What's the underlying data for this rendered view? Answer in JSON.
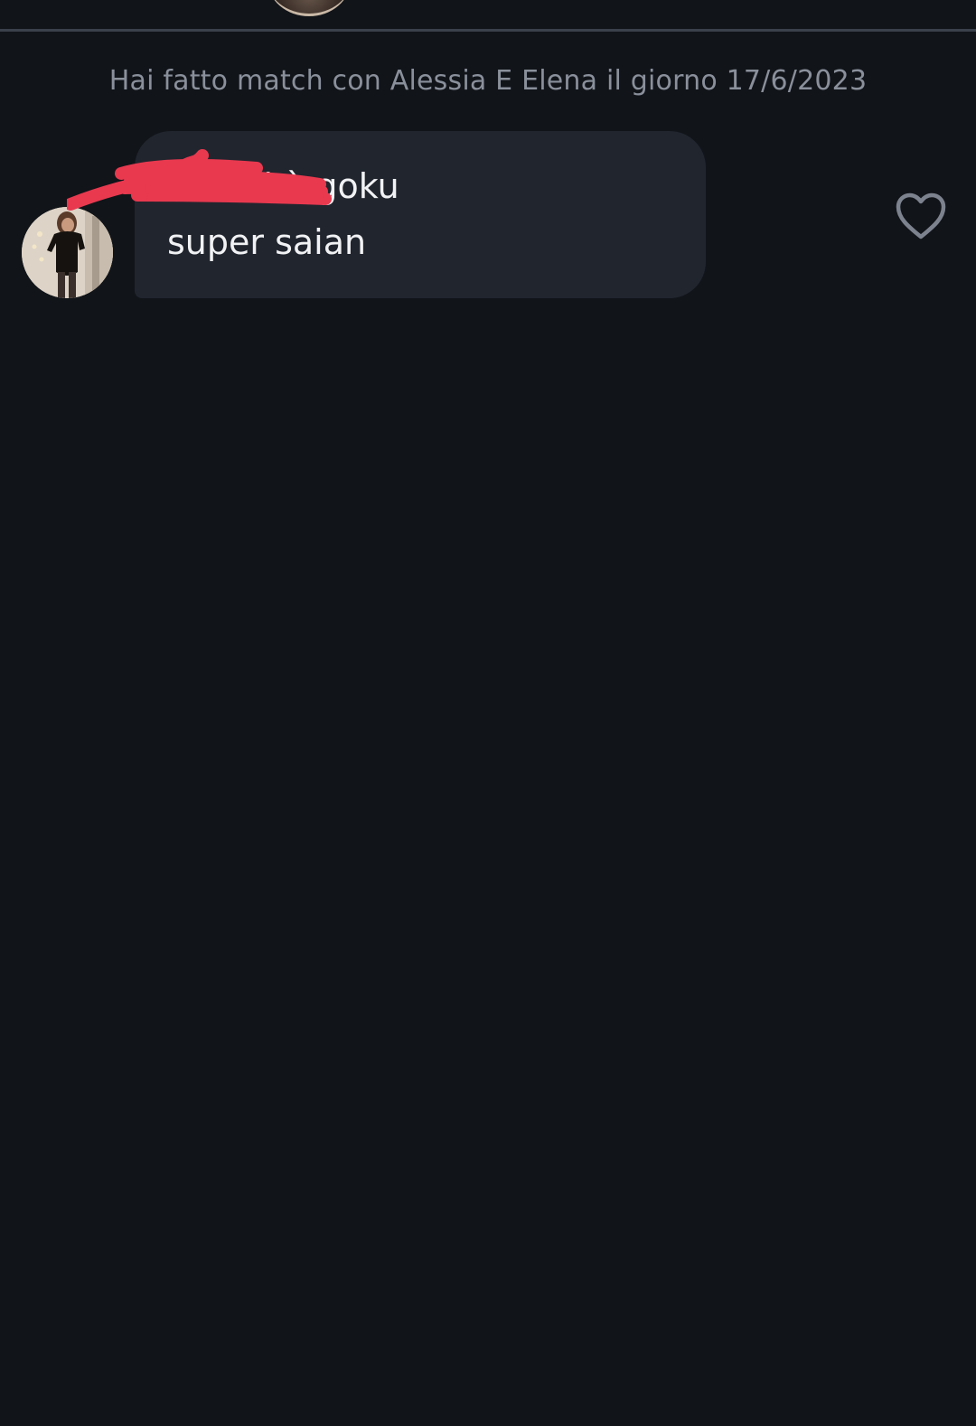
{
  "chat": {
    "match_notice": "Hai fatto match con Alessia E Elena il giorno 17/6/2023",
    "messages": [
      {
        "sender": "match",
        "text": "ma lei è goku\nsuper saian",
        "liked": false
      }
    ]
  },
  "icons": {
    "like": "heart-outline-icon"
  },
  "colors": {
    "background": "#111419",
    "bubble": "#21252e",
    "notice_text": "#8a909b",
    "message_text": "#f1f2f4",
    "heart_outline": "#7d838e",
    "redaction_marker": "#e8394f"
  }
}
